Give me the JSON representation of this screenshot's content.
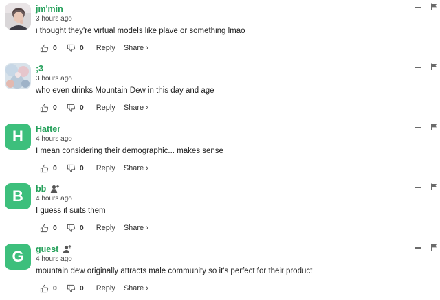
{
  "comments": [
    {
      "username": "jm'min",
      "time": "3 hours ago",
      "text": "i thought they're virtual models like plave or something lmao",
      "upvotes": "0",
      "downvotes": "0",
      "reply": "Reply",
      "share": "Share ›",
      "avatar_type": "photo-portrait"
    },
    {
      "username": ";3",
      "time": "3 hours ago",
      "text": "who even drinks Mountain Dew in this day and age",
      "upvotes": "0",
      "downvotes": "0",
      "reply": "Reply",
      "share": "Share ›",
      "avatar_type": "photo-pastel"
    },
    {
      "username": "Hatter",
      "time": "4 hours ago",
      "text": "I mean considering their demographic... makes sense",
      "upvotes": "0",
      "downvotes": "0",
      "reply": "Reply",
      "share": "Share ›",
      "avatar_letter": "H"
    },
    {
      "username": "bb",
      "time": "4 hours ago",
      "text": "I guess it suits them",
      "upvotes": "0",
      "downvotes": "0",
      "reply": "Reply",
      "share": "Share ›",
      "avatar_letter": "B",
      "guest_icon": "user-add-icon"
    },
    {
      "username": "guest",
      "time": "4 hours ago",
      "text": "mountain dew originally attracts male community so it's perfect for their product",
      "upvotes": "0",
      "downvotes": "0",
      "reply": "Reply",
      "share": "Share ›",
      "avatar_letter": "G",
      "guest_icon": "user-add-icon"
    }
  ],
  "colors": {
    "accent": "#24a05a",
    "avatar_bg": "#3dbf7c",
    "icon_gray": "#6b6b6b"
  }
}
